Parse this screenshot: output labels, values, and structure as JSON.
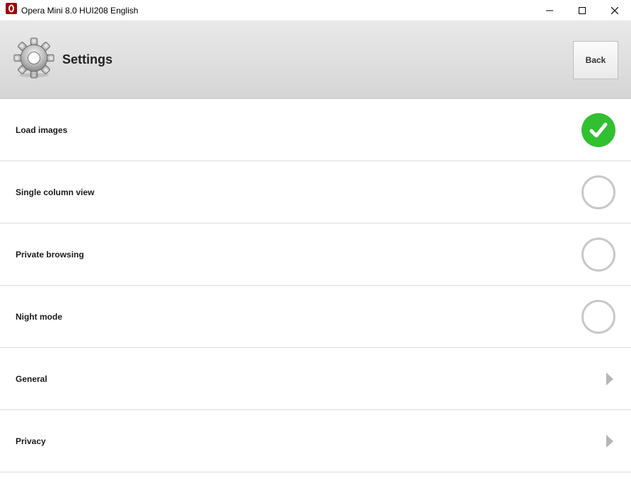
{
  "window": {
    "title": "Opera Mini  8.0 HUI208 English"
  },
  "header": {
    "title": "Settings",
    "back_label": "Back"
  },
  "rows": {
    "load_images": {
      "label": "Load images"
    },
    "single_column_view": {
      "label": "Single column view"
    },
    "private_browsing": {
      "label": "Private browsing"
    },
    "night_mode": {
      "label": "Night mode"
    },
    "general": {
      "label": "General"
    },
    "privacy": {
      "label": "Privacy"
    }
  }
}
